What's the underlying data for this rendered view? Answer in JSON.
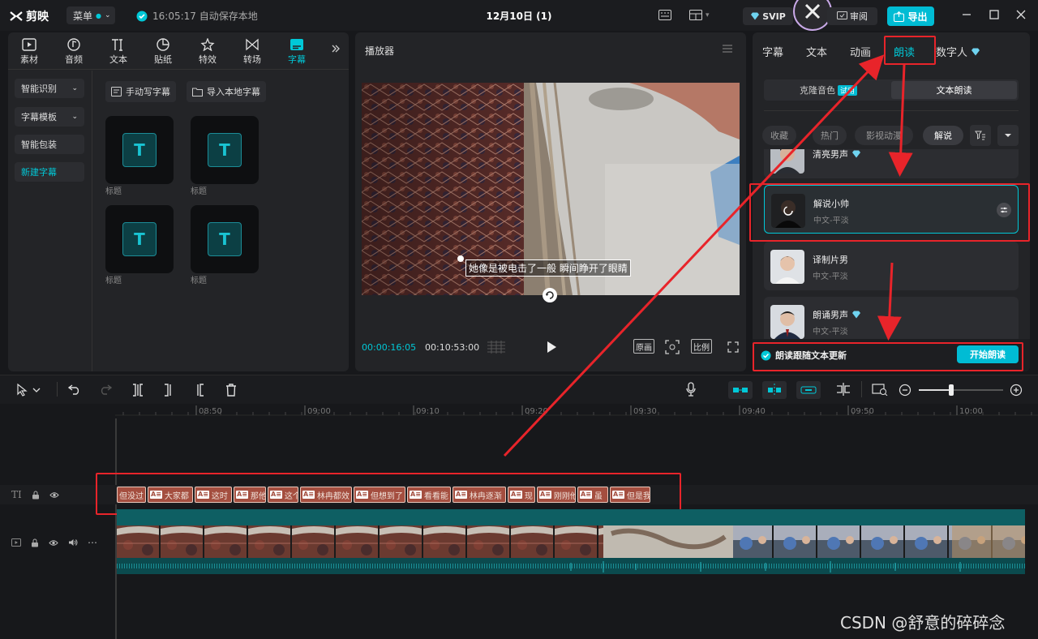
{
  "app": {
    "brand": "剪映",
    "menu_label": "菜单",
    "saved_status": "16:05:17 自动保存本地",
    "project_title": "12月10日 (1)",
    "svip_label": "SVIP",
    "review_label": "审阅",
    "export_label": "导出"
  },
  "left_panel": {
    "tabs": [
      {
        "label": "素材",
        "icon": "media-icon"
      },
      {
        "label": "音频",
        "icon": "audio-icon"
      },
      {
        "label": "文本",
        "icon": "text-icon"
      },
      {
        "label": "贴纸",
        "icon": "sticker-icon"
      },
      {
        "label": "特效",
        "icon": "effects-icon"
      },
      {
        "label": "转场",
        "icon": "transition-icon"
      },
      {
        "label": "字幕",
        "icon": "subtitle-icon",
        "active": true
      }
    ],
    "side_items": [
      {
        "label": "智能识别"
      },
      {
        "label": "字幕模板"
      },
      {
        "label": "智能包装"
      },
      {
        "label": "新建字幕",
        "active": true
      }
    ],
    "buttons": {
      "manual": "手动写字幕",
      "import": "导入本地字幕"
    },
    "templates": [
      {
        "label": "标题"
      },
      {
        "label": "标题"
      },
      {
        "label": "标题"
      },
      {
        "label": "标题"
      }
    ]
  },
  "player": {
    "title": "播放器",
    "subtitle_text": "她像是被电击了一般 瞬间睁开了眼睛",
    "current_time": "00:00:16:05",
    "total_time": "00:10:53:00",
    "btn_original": "原画",
    "btn_ratio": "比例"
  },
  "right_panel": {
    "tabs": [
      "字幕",
      "文本",
      "动画",
      "朗读",
      "数字人"
    ],
    "active_tab": "朗读",
    "segment": {
      "clone_label": "克隆音色",
      "clone_badge": "试用",
      "text_read_label": "文本朗读"
    },
    "filters": [
      "收藏",
      "热门",
      "影视动漫",
      "解说"
    ],
    "active_filter": "解说",
    "voices": [
      {
        "name": "清亮男声",
        "sub": "",
        "vip": true
      },
      {
        "name": "解说小帅",
        "sub": "中文-平淡",
        "selected": true
      },
      {
        "name": "译制片男",
        "sub": "中文-平淡"
      },
      {
        "name": "朗诵男声",
        "sub": "中文-平淡",
        "vip": true
      }
    ],
    "follow_label": "朗读跟随文本更新",
    "start_button": "开始朗读"
  },
  "timeline": {
    "ruler_ticks": [
      "08:50",
      "09:00",
      "09:10",
      "09:20",
      "09:30",
      "09:40",
      "09:50",
      "10:00"
    ],
    "subtitle_clips": [
      "但没过",
      "大家都",
      "这时",
      "那他",
      "这个",
      "林冉都效",
      "但想到了",
      "看看能",
      "林冉逐渐",
      "现",
      "刚刚他",
      "虽",
      "但是我"
    ]
  },
  "watermark": "CSDN @舒意的碎碎念"
}
